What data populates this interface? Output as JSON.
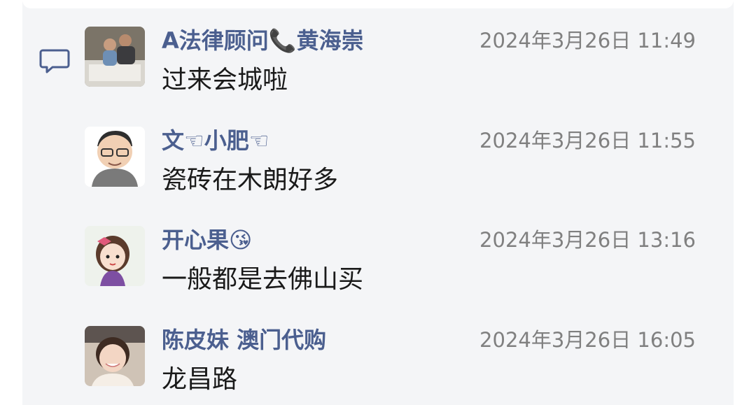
{
  "messages": [
    {
      "name": "A法律顾问📞黄海崇",
      "timestamp": "2024年3月26日 11:49",
      "text": "过来会城啦",
      "avatar": "photo-two-people-at-table"
    },
    {
      "name": "文☜小肥☜",
      "timestamp": "2024年3月26日 11:55",
      "text": "瓷砖在木朗好多",
      "avatar": "cartoon-man-with-glasses"
    },
    {
      "name": "开心果😘",
      "timestamp": "2024年3月26日 13:16",
      "text": "一般都是去佛山买",
      "avatar": "cartoon-girl-with-bow"
    },
    {
      "name": "陈皮妹 澳门代购",
      "timestamp": "2024年3月26日 16:05",
      "text": "龙昌路",
      "avatar": "photo-smiling-child"
    }
  ],
  "icons": {
    "comment": "comment-bubble-icon"
  },
  "colors": {
    "name": "#4b5f8f",
    "timestamp": "#808080",
    "text": "#1a1a1a",
    "background": "#f4f5f7"
  }
}
